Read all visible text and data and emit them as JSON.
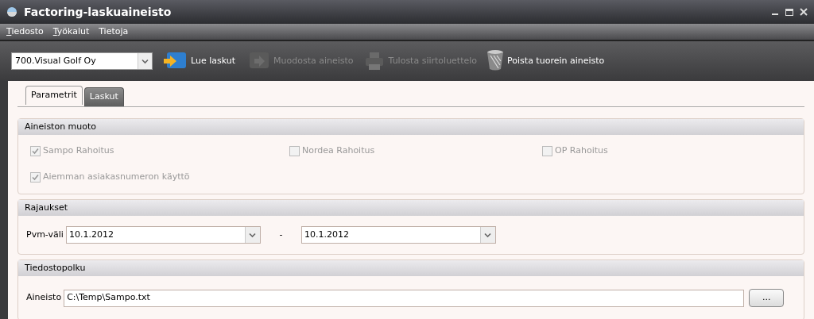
{
  "window": {
    "title": "Factoring-laskuaineisto"
  },
  "menu": [
    {
      "label": "Tiedosto",
      "accel": true
    },
    {
      "label": "Työkalut",
      "accel": true
    },
    {
      "label": "Tietoja",
      "accel": false
    }
  ],
  "toolbar": {
    "company": "700.Visual Golf Oy",
    "buttons": [
      {
        "kind": "load",
        "label": "Lue laskut",
        "disabled": false
      },
      {
        "kind": "build",
        "label": "Muodosta aineisto",
        "disabled": true
      },
      {
        "kind": "print",
        "label": "Tulosta siirtoluettelo",
        "disabled": true
      },
      {
        "kind": "delete",
        "label": "Poista tuorein aineisto",
        "disabled": false
      }
    ]
  },
  "tabs": [
    {
      "label": "Parametrit",
      "selected": true
    },
    {
      "label": "Laskut",
      "selected": false
    }
  ],
  "sections": [
    {
      "kind": "checks",
      "title": "Aineiston muoto",
      "items": [
        {
          "label": "Sampo Rahoitus",
          "checked": true,
          "disabled": true
        },
        {
          "label": "Nordea Rahoitus",
          "checked": false,
          "disabled": true
        },
        {
          "label": "OP Rahoitus",
          "checked": false,
          "disabled": true
        },
        {
          "label": "Aiemman asiakasnumeron käyttö",
          "checked": true,
          "disabled": true
        }
      ]
    },
    {
      "kind": "range",
      "title": "Rajaukset",
      "label": "Pvm-väli",
      "from": "10.1.2012",
      "separator": "-",
      "to": "10.1.2012"
    },
    {
      "kind": "path",
      "title": "Tiedostopolku",
      "label": "Aineisto",
      "value": "C:\\Temp\\Sampo.txt",
      "browse": "..."
    }
  ]
}
